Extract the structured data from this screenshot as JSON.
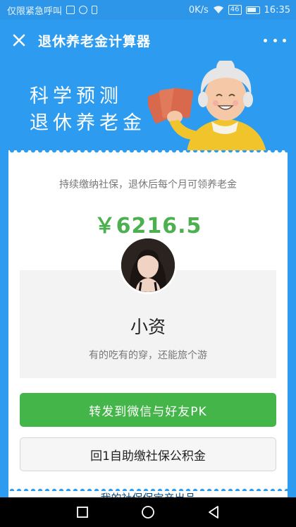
{
  "status_bar": {
    "left_text": "仅限紧急呼叫",
    "speed": "0K/s",
    "network_tag": "46",
    "time": "16:35"
  },
  "nav": {
    "title": "退休养老金计算器",
    "close_icon": "close-icon",
    "more_icon": "more-icon"
  },
  "hero": {
    "line1": "科学预测",
    "line2": "退休养老金",
    "illustration": "grandma-holding-money"
  },
  "result": {
    "subtitle": "持续缴纳社保，退休后每个月可领养老金",
    "amount": "￥6216.5",
    "persona_name": "小资",
    "persona_desc": "有的吃有的穿，还能旅个游"
  },
  "buttons": {
    "share_label": "转发到微信与好友PK",
    "social_label": "回1自助缴社保公积金"
  },
  "footer": {
    "text": "我的社保保宝产出品"
  },
  "colors": {
    "background": "#2d9cf0",
    "accent_green": "#44b549",
    "amount_green": "#4caf50"
  }
}
